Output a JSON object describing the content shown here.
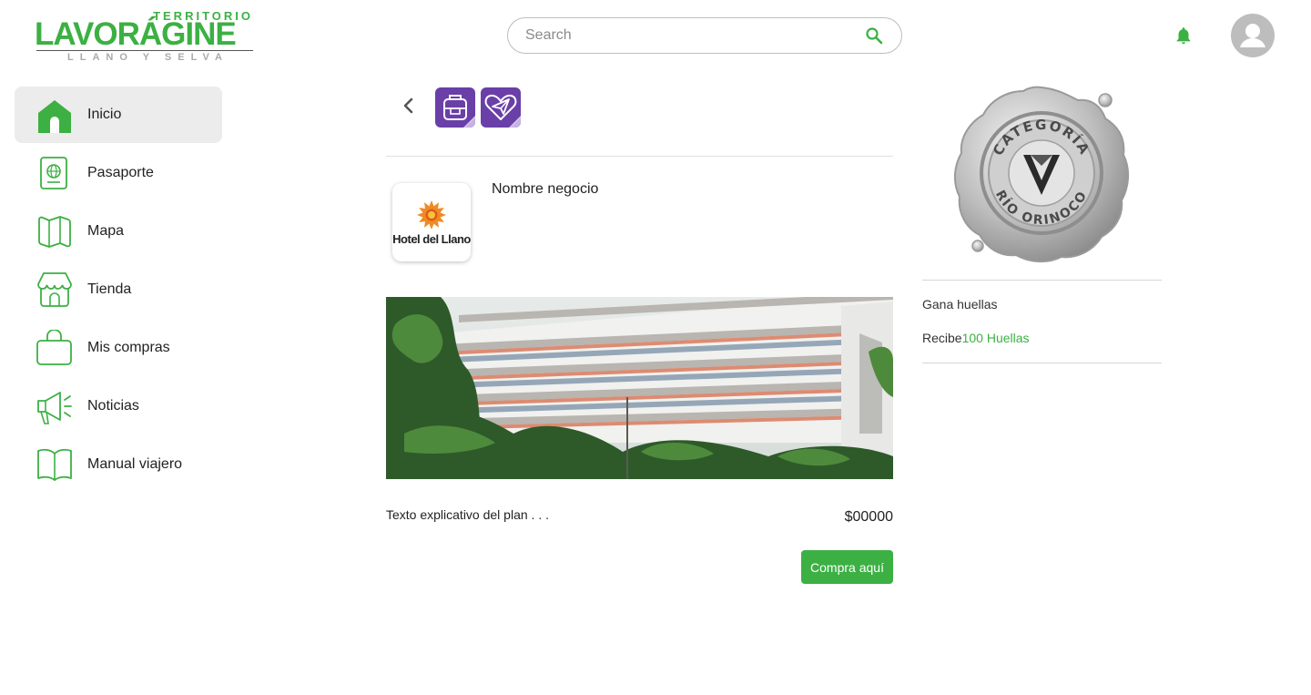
{
  "brand": {
    "top": "TERRITORIO",
    "main": "LAVORÁGINE",
    "sub": "LLANO Y SELVA",
    "color": "#3cb043"
  },
  "search": {
    "placeholder": "Search"
  },
  "sidebar": {
    "items": [
      {
        "label": "Inicio",
        "icon": "home-icon",
        "active": true
      },
      {
        "label": "Pasaporte",
        "icon": "passport-icon"
      },
      {
        "label": "Mapa",
        "icon": "map-icon"
      },
      {
        "label": "Tienda",
        "icon": "store-icon"
      },
      {
        "label": "Mis compras",
        "icon": "shopping-bag-icon"
      },
      {
        "label": "Noticias",
        "icon": "megaphone-icon"
      },
      {
        "label": "Manual viajero",
        "icon": "book-icon"
      }
    ]
  },
  "business": {
    "logo_text": "Hotel del Llano",
    "name": "Nombre negocio"
  },
  "plan": {
    "description": "Texto explicativo del plan . . .",
    "price": "$00000",
    "buy_label": "Compra aquí"
  },
  "rewards": {
    "seal_text_top": "CATEGORÍA",
    "seal_text_bottom": "RÍO ORINOCO",
    "title": "Gana huellas",
    "receive_label": "Recibe",
    "receive_amount": "100 Huellas"
  }
}
